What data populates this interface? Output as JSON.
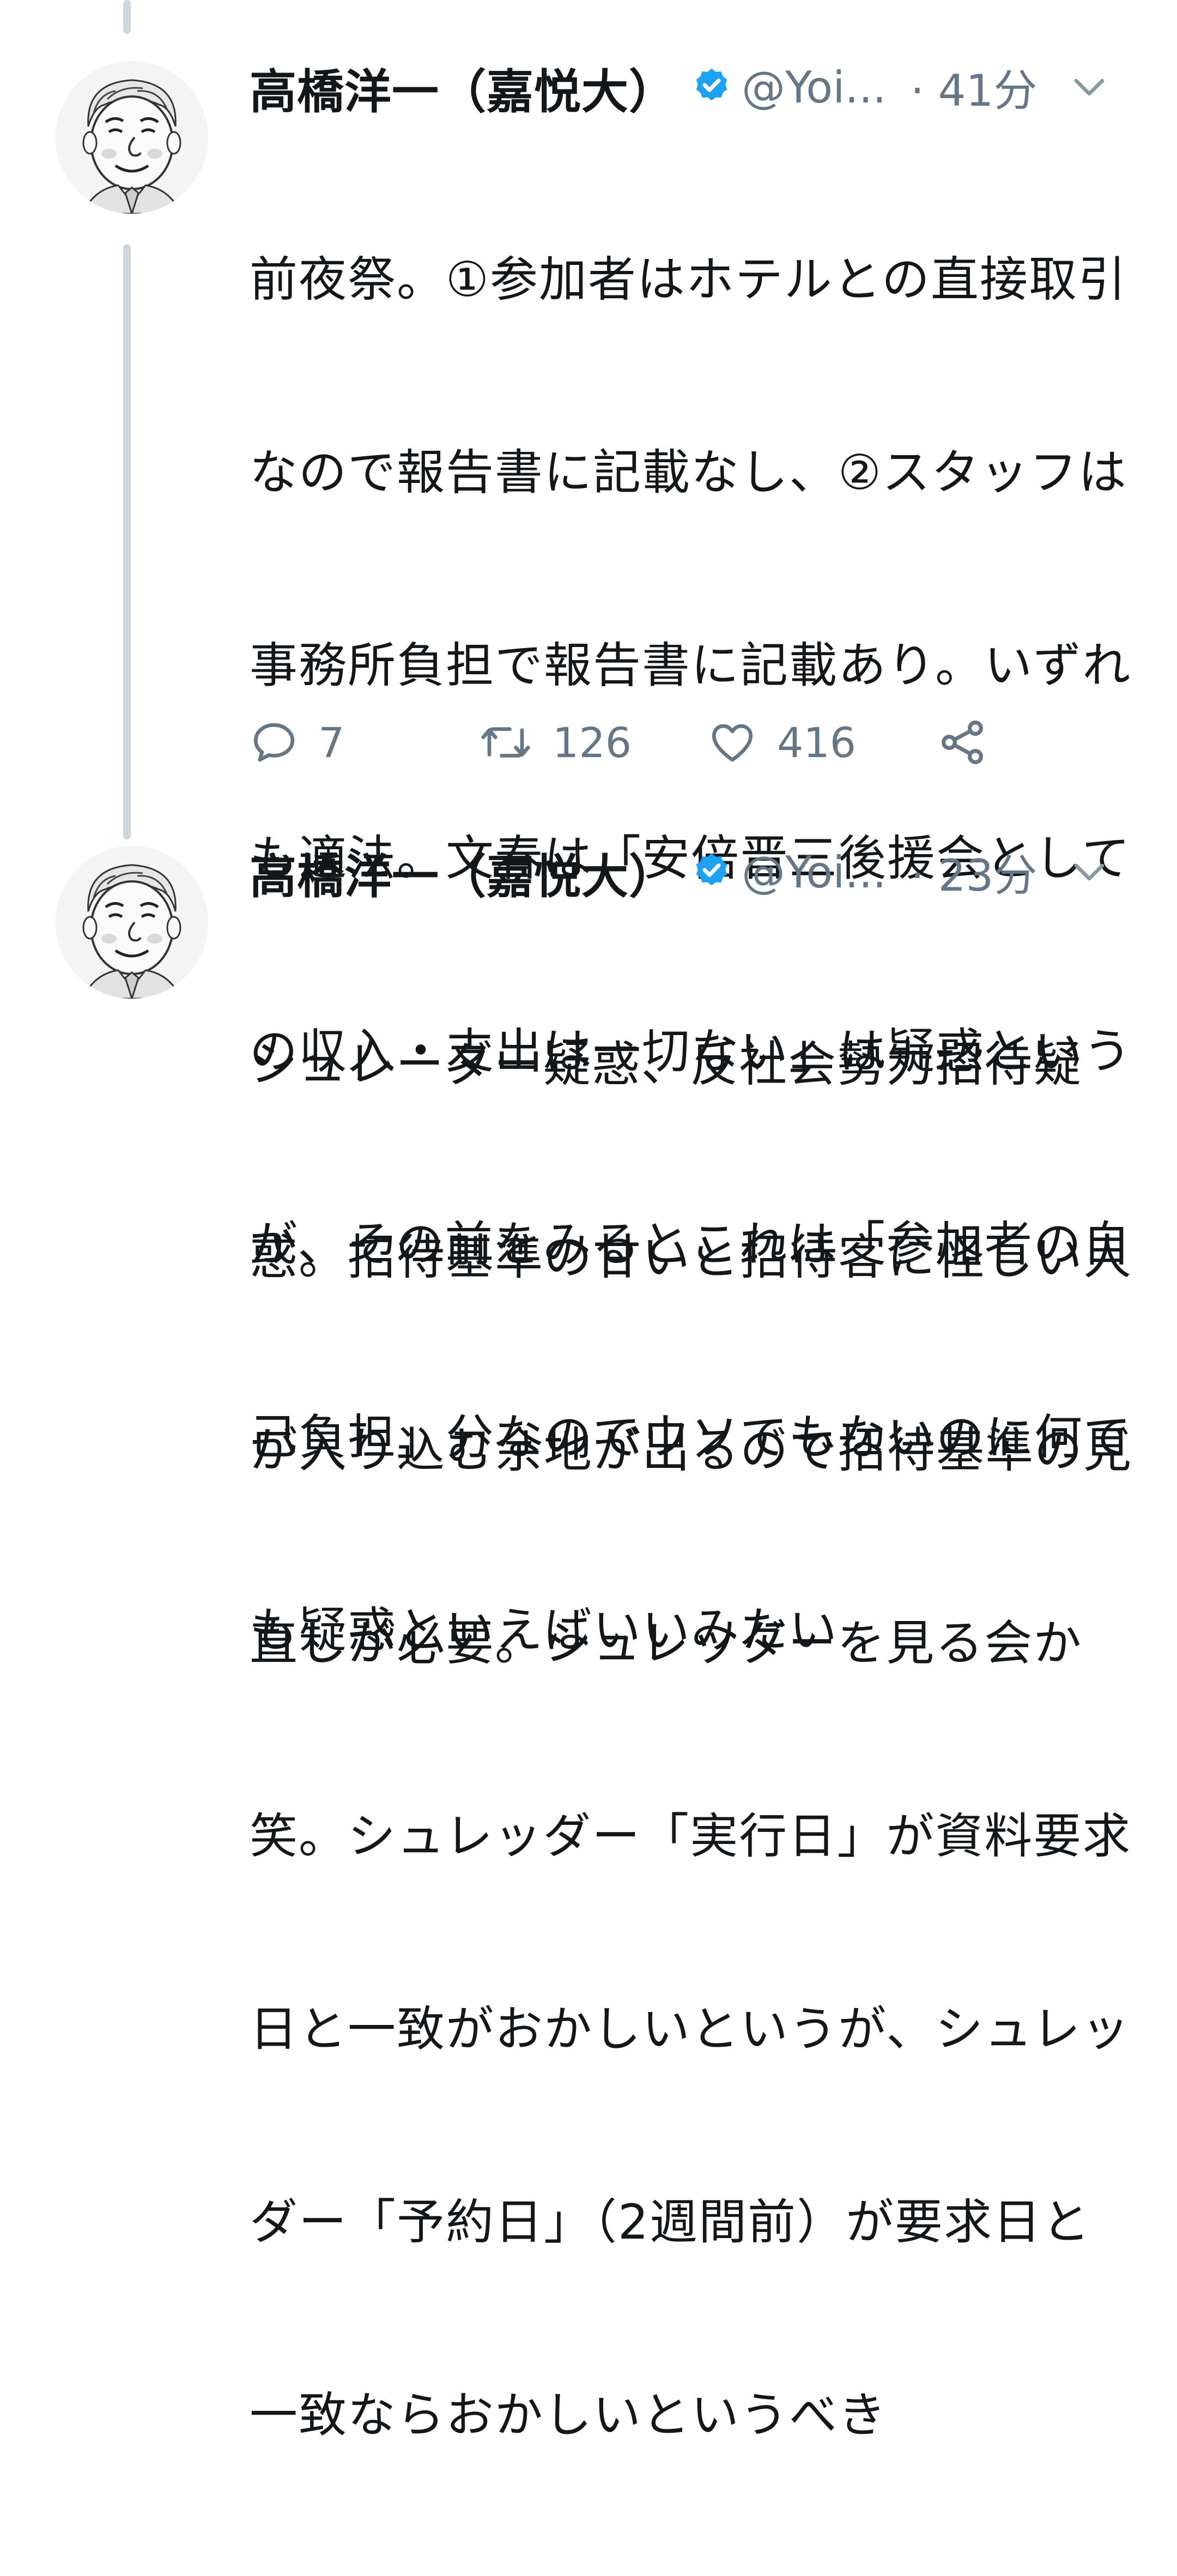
{
  "tweets": [
    {
      "display_name": "高橋洋一（嘉悦大）",
      "handle": "@Yoi...",
      "time": "· 41分",
      "lines": [
        "前夜祭。①参加者はホテルとの直接取引",
        "なので報告書に記載なし、②スタッフは",
        "事務所負担で報告書に記載あり。いずれ",
        "も適法。文春は「安倍晋三後援会として",
        "の収入・支出は一切ない」は疑惑という",
        "が、その前をみるとこれは「参加者の自",
        "己負担」分なのでウソでもないのに何で",
        "も疑惑といえばいいみたい"
      ],
      "reply_count": "7",
      "retweet_count": "126",
      "like_count": "416"
    },
    {
      "display_name": "高橋洋一（嘉悦大）",
      "handle": "@Yoi...",
      "time": "· 23分",
      "lines": [
        "シュレーダー疑惑、反社会勢力招待疑",
        "惑。招待基準の甘いと招待客に怪しい人",
        "が入り込む余地が出るので招待基準の見",
        "直しが必要。シュレッダーを見る会か",
        "笑。シュレッダー「実行日」が資料要求",
        "日と一致がおかしいというが、シュレッ",
        "ダー「予約日」（2週間前）が要求日と",
        "一致ならおかしいというべき"
      ]
    }
  ],
  "icons": {
    "verified": "verified-badge-icon",
    "caret": "chevron-down-icon",
    "reply": "reply-icon",
    "retweet": "retweet-icon",
    "like": "heart-icon",
    "share": "share-icon"
  },
  "colors": {
    "text": "#14171a",
    "secondary": "#657786",
    "verified": "#1da1f2",
    "thread_line": "#ccd6dd"
  }
}
